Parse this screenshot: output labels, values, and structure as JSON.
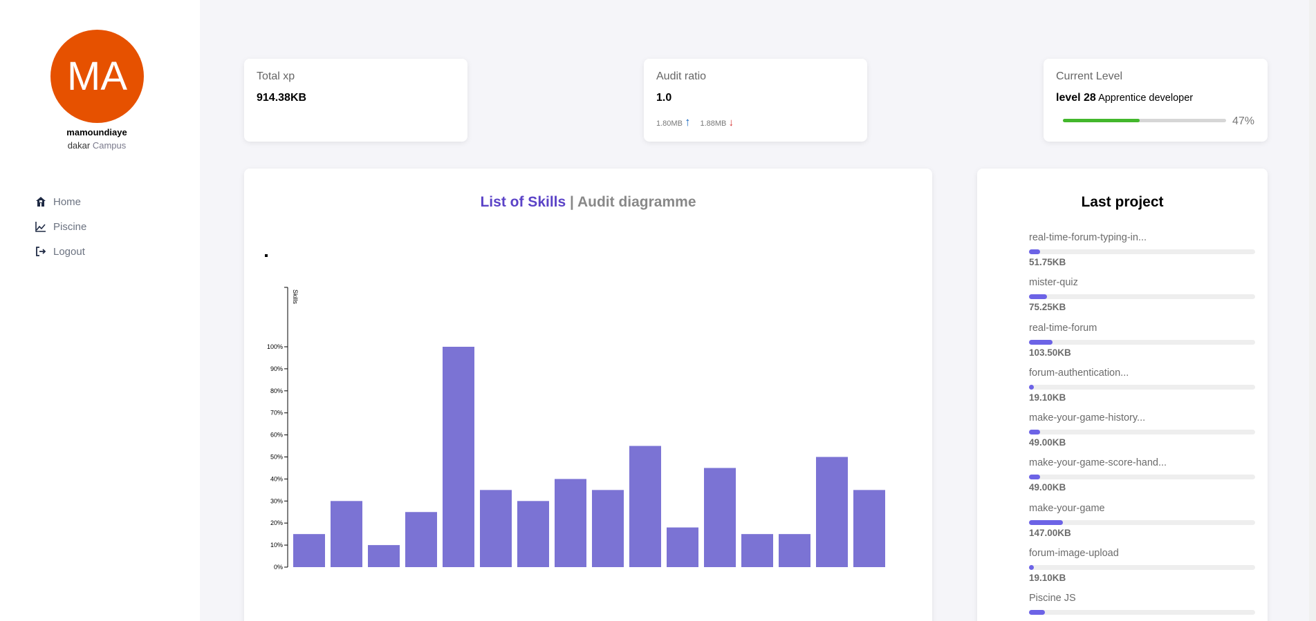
{
  "profile": {
    "initials": "MA",
    "login": "mamoundiaye",
    "city": "dakar",
    "campus_word": "Campus"
  },
  "nav": [
    {
      "label": "Home",
      "icon": "house-icon"
    },
    {
      "label": "Piscine",
      "icon": "chart-line-icon"
    },
    {
      "label": "Logout",
      "icon": "logout-icon"
    }
  ],
  "stats": {
    "total_xp": {
      "title": "Total xp",
      "value": "914.38KB"
    },
    "audit": {
      "title": "Audit ratio",
      "value": "1.0",
      "done": "1.80MB",
      "received": "1.88MB",
      "done_color": "#1565c0",
      "received_color": "#d32f2f"
    },
    "level": {
      "title": "Current Level",
      "level_label": "level 28",
      "rank": "Apprentice developer",
      "progress": 0.47,
      "progress_text": "47%",
      "bar_color": "#43b72c"
    }
  },
  "skills_panel": {
    "title_active": "List of Skills",
    "separator": "|",
    "title_inactive": "Audit diagramme"
  },
  "chart_data": {
    "type": "bar",
    "ylabel": "Skills",
    "ylim": [
      0,
      100
    ],
    "yticks": [
      "0%",
      "10%",
      "20%",
      "30%",
      "40%",
      "50%",
      "60%",
      "70%",
      "80%",
      "90%",
      "100%"
    ],
    "values": [
      15,
      30,
      10,
      25,
      100,
      35,
      30,
      40,
      35,
      55,
      18,
      45,
      15,
      15,
      50,
      35
    ],
    "bar_color": "#7b73d4",
    "grid": false
  },
  "last_project": {
    "title": "Last project",
    "items": [
      {
        "name": "real-time-forum-typing-in...",
        "size": "51.75KB",
        "fill": 0.05
      },
      {
        "name": "mister-quiz",
        "size": "75.25KB",
        "fill": 0.08
      },
      {
        "name": "real-time-forum",
        "size": "103.50KB",
        "fill": 0.105
      },
      {
        "name": "forum-authentication...",
        "size": "19.10KB",
        "fill": 0.02
      },
      {
        "name": "make-your-game-history...",
        "size": "49.00KB",
        "fill": 0.05
      },
      {
        "name": "make-your-game-score-hand...",
        "size": "49.00KB",
        "fill": 0.05
      },
      {
        "name": "make-your-game",
        "size": "147.00KB",
        "fill": 0.15
      },
      {
        "name": "forum-image-upload",
        "size": "19.10KB",
        "fill": 0.02
      },
      {
        "name": "Piscine JS",
        "size": "",
        "fill": 0.07
      }
    ],
    "bar_color": "#6c63e6"
  }
}
